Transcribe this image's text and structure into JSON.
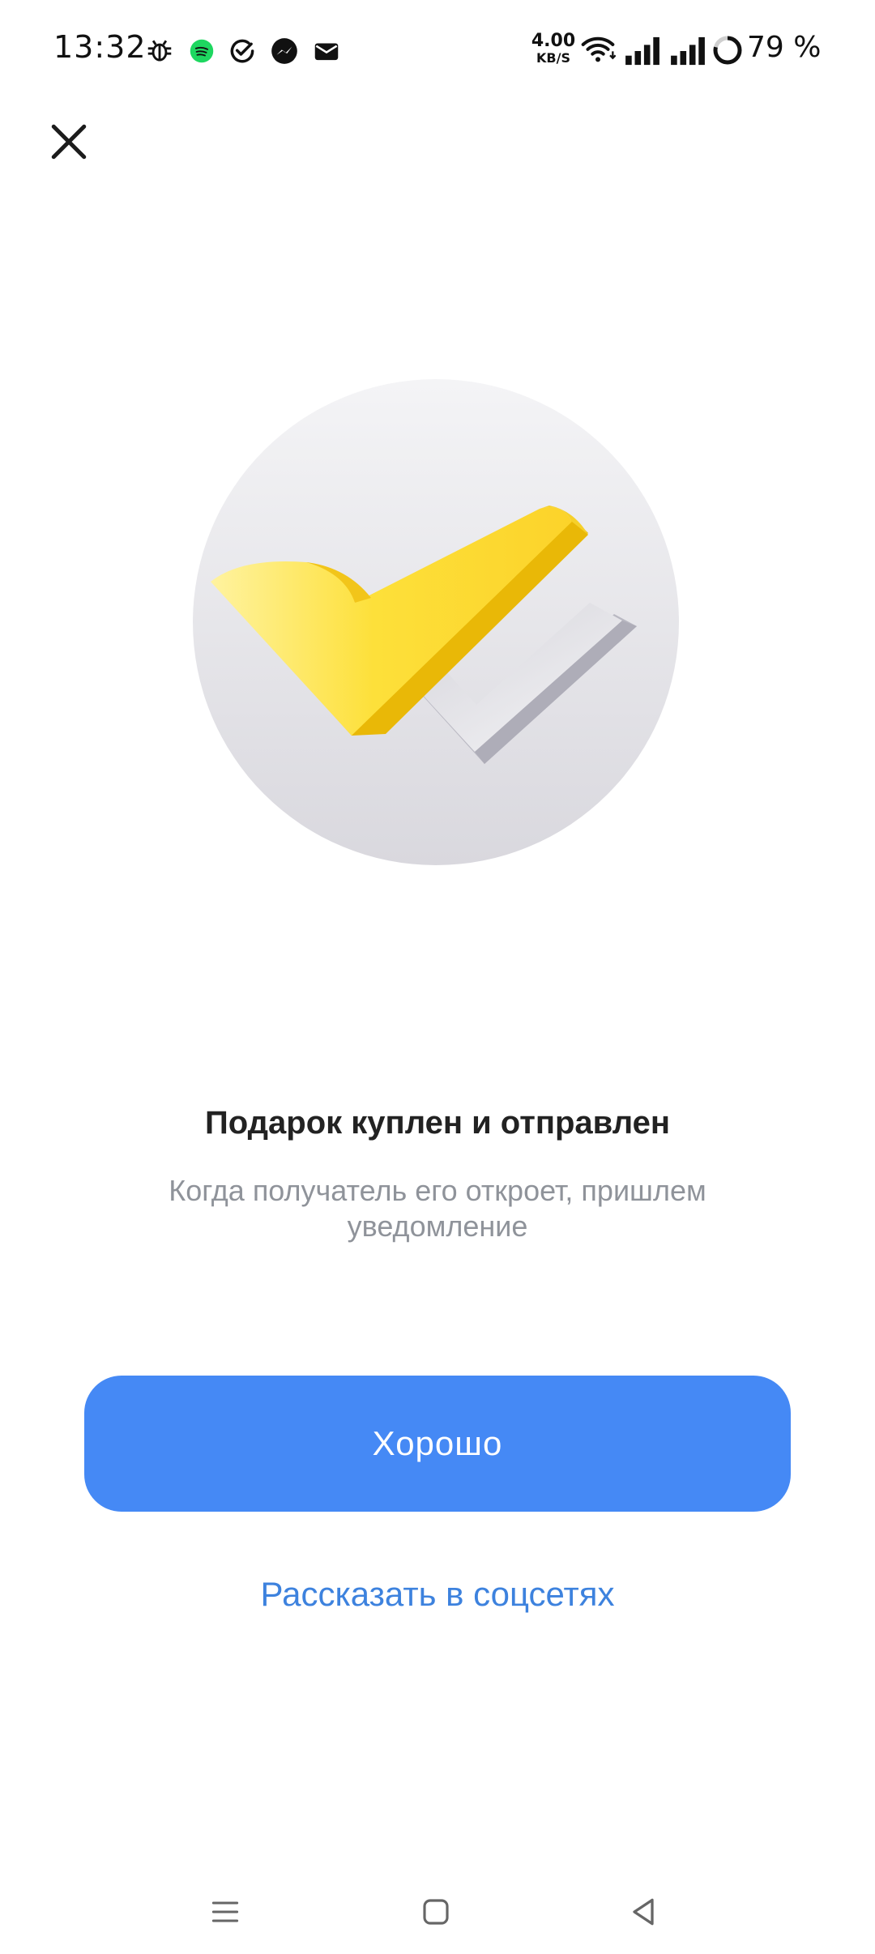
{
  "status_bar": {
    "time": "13:32",
    "net_speed_value": "4.00",
    "net_speed_unit": "KB/S",
    "battery": "79 %",
    "icons": [
      "bug-icon",
      "spotify-icon",
      "check-circle-icon",
      "messenger-icon",
      "mail-icon",
      "wifi-icon",
      "signal-icon",
      "signal-icon",
      "battery-ring-icon"
    ]
  },
  "header": {
    "close_icon": "close-icon"
  },
  "illustration": {
    "icon": "double-check-icon",
    "colors": {
      "circle": "#e6e6ea",
      "primary_check": "#fcd52c",
      "secondary_check": "#d8d8de"
    }
  },
  "content": {
    "title": "Подарок куплен и отправлен",
    "subtitle": "Когда получатель его откроет, пришлем уведомление"
  },
  "actions": {
    "primary_label": "Хорошо",
    "secondary_label": "Рассказать в соцсетях"
  },
  "nav_bar": {
    "items": [
      "menu-icon",
      "home-icon",
      "back-icon"
    ]
  },
  "colors": {
    "accent": "#4589f5",
    "link": "#3d82de",
    "subtitle": "#8f939a"
  }
}
